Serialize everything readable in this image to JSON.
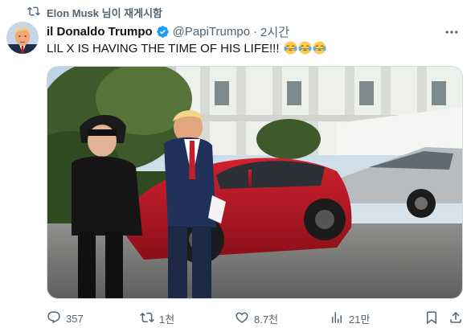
{
  "retweet_banner": {
    "text": "Elon Musk 님이 재게시함",
    "icon": "repost-icon"
  },
  "author": {
    "name": "il Donaldo Trumpo",
    "handle": "@PapiTrumpo",
    "separator": "·",
    "time": "2시간",
    "verified_color": "#1d9bf0"
  },
  "tweet": {
    "text": "LIL X IS HAVING THE TIME OF HIS LIFE!!!",
    "emoji_count": 3,
    "emoji_name": "face-with-tears-of-joy-emoji"
  },
  "actions": {
    "reply": {
      "icon": "reply-icon",
      "count": "357"
    },
    "repost": {
      "icon": "repost-icon",
      "count": "1천"
    },
    "like": {
      "icon": "heart-icon",
      "count": "8.7천"
    },
    "views": {
      "icon": "views-icon",
      "count": "21만"
    },
    "bookmark": {
      "icon": "bookmark-icon"
    },
    "share": {
      "icon": "share-icon"
    }
  },
  "colors": {
    "text_primary": "#0f1419",
    "text_secondary": "#536471",
    "accent": "#1d9bf0"
  }
}
